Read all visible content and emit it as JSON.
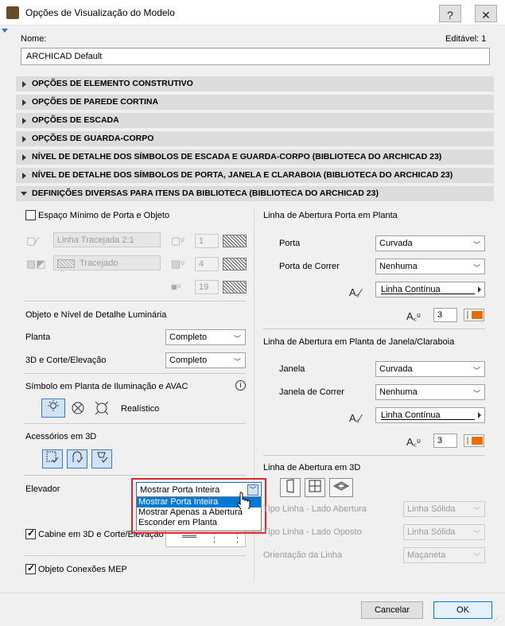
{
  "window": {
    "title": "Opções de Visualização do Modelo",
    "help": "?",
    "close": "✕"
  },
  "header": {
    "name_label": "Nome:",
    "editable": "Editável: 1",
    "name_value": "ARCHICAD Default"
  },
  "sections": [
    "OPÇÕES DE ELEMENTO CONSTRUTIVO",
    "OPÇÕES DE PAREDE CORTINA",
    "OPÇÕES DE ESCADA",
    "OPÇÕES DE GUARDA-CORPO",
    "NÍVEL DE DETALHE DOS SÍMBOLOS DE ESCADA E GUARDA-CORPO (BIBLIOTECA DO ARCHICAD 23)",
    "NÍVEL DE DETALHE DOS SÍMBOLOS DE PORTA, JANELA E CLARABOIA (BIBLIOTECA DO ARCHICAD 23)",
    "DEFINIÇÕES DIVERSAS PARA ITENS DA BIBLIOTECA (BIBLIOTECA DO ARCHICAD 23)"
  ],
  "left": {
    "min_space_label": "Espaço Mínimo de Porta e Objeto",
    "linetype_value": "Linha Tracejada 2:1",
    "fill_value": "Tracejado",
    "pen1": "1",
    "pen2": "4",
    "pen3": "19",
    "object_detail_title": "Objeto e Nível de Detalhe Luminária",
    "plan_label": "Planta",
    "plan_value": "Completo",
    "section_label": "3D e Corte/Elevação",
    "section_value": "Completo",
    "lighting_title": "Símbolo em Planta de Iluminação e AVAC",
    "realistic_label": "Realístico",
    "accessories_title": "Acessórios em 3D",
    "elevator_label": "Elevador",
    "elevator_value": "Mostrar Porta Inteira",
    "elevator_options": [
      "Mostrar Porta Inteira",
      "Mostrar Apenas a Abertura",
      "Esconder em Planta"
    ],
    "cabin_label": "Cabine em 3D e Corte/Elevação",
    "mep_label": "Objeto Conexões MEP"
  },
  "right": {
    "door_plan_title": "Linha de Abertura Porta em Planta",
    "door_label": "Porta",
    "door_value": "Curvada",
    "sliding_door_label": "Porta de Correr",
    "sliding_door_value": "Nenhuma",
    "door_line_value": "Linha Contínua",
    "door_pen": "3",
    "window_plan_title": "Linha de Abertura em Planta de Janela/Claraboia",
    "window_label": "Janela",
    "window_value": "Curvada",
    "sliding_window_label": "Janela de Correr",
    "sliding_window_value": "Nenhuma",
    "window_line_value": "Linha Contínua",
    "window_pen": "3",
    "opening3d_title": "Linha de Abertura em 3D",
    "linetype_open_label": "Tipo Linha - Lado Abertura",
    "linetype_open_value": "Linha Sólida",
    "linetype_opposite_label": "Tipo Linha - Lado Oposto",
    "linetype_opposite_value": "Linha Sólida",
    "orientation_label": "Orientação da Linha",
    "orientation_value": "Maçaneta"
  },
  "footer": {
    "cancel": "Cancelar",
    "ok": "OK"
  },
  "colors": {
    "highlight": "#e0262b",
    "selection": "#0078d7",
    "accent_orange": "#f06a00"
  }
}
